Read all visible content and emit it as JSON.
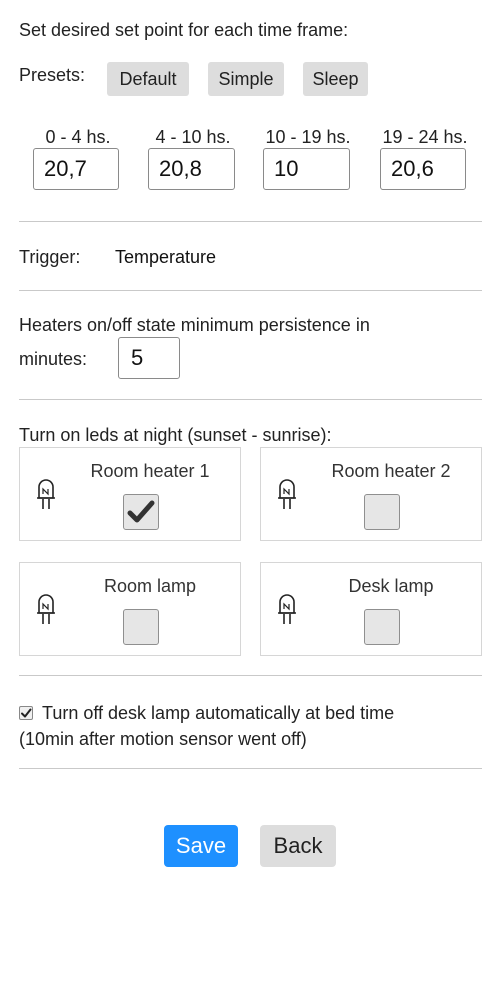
{
  "heading": "Set desired set point for each time frame:",
  "presets": {
    "label": "Presets:",
    "buttons": [
      "Default",
      "Simple",
      "Sleep"
    ]
  },
  "frames": [
    {
      "label": "0 - 4 hs.",
      "value": "20,7"
    },
    {
      "label": "4 - 10 hs.",
      "value": "20,8"
    },
    {
      "label": "10 - 19 hs.",
      "value": "10"
    },
    {
      "label": "19 - 24 hs.",
      "value": "20,6"
    }
  ],
  "trigger": {
    "label": "Trigger:",
    "value": "Temperature"
  },
  "persistence": {
    "label_line1": "Heaters on/off state minimum persistence in",
    "label_line2": "minutes:",
    "value": "5"
  },
  "leds": {
    "title": "Turn on leds at night (sunset - sunrise):",
    "icon": "led-icon",
    "items": [
      {
        "name": "Room heater 1",
        "checked": true
      },
      {
        "name": "Room heater 2",
        "checked": false
      },
      {
        "name": "Room lamp",
        "checked": false
      },
      {
        "name": "Desk lamp",
        "checked": false
      }
    ]
  },
  "desk_lamp_option": {
    "checked": true,
    "line1": "Turn off desk lamp automatically at bed time",
    "line2": "(10min after motion sensor went off)"
  },
  "actions": {
    "save": "Save",
    "back": "Back"
  },
  "colors": {
    "save_button": "#1e90ff",
    "neutral_button": "#dddddd"
  }
}
